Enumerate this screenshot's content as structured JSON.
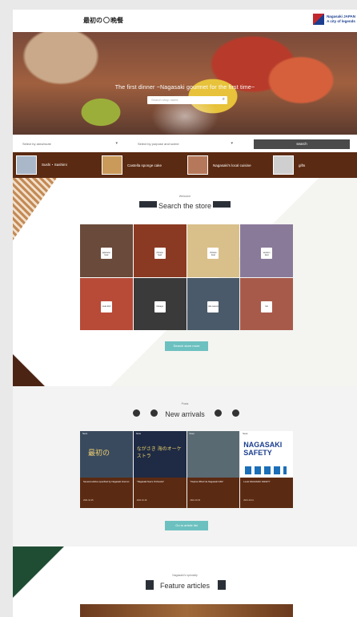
{
  "header": {
    "logo_text_left": "最初の",
    "logo_text_right": "晩餐",
    "brand_line1": "Nagasaki JAPAN",
    "brand_line2": "A city of legends"
  },
  "hero": {
    "title": "The first dinner ~Nagasaki gourmet for the first time~",
    "search_placeholder": "Search shop name"
  },
  "filters": {
    "area_label": "Select by area/route",
    "purpose_label": "Select by purpose and scene",
    "search_label": "search"
  },
  "categories": [
    {
      "label": "Sushi・Sashimi",
      "color": "#a9b7c9"
    },
    {
      "label": "Castella sponge cake",
      "color": "#c99a5a"
    },
    {
      "label": "Nagasaki's local cuisine",
      "color": "#b6785a"
    },
    {
      "label": "gifts",
      "color": "#cfcfcf"
    }
  ],
  "store_section": {
    "kicker": "Welcome",
    "title": "Search the store",
    "more_label": "Search store more",
    "tiles": [
      {
        "badge": "japanese food",
        "color": "#6a4a3a"
      },
      {
        "badge": "chinese food",
        "color": "#8a3a22"
      },
      {
        "badge": "chinese food",
        "color": "#d9c08a"
      },
      {
        "badge": "western food",
        "color": "#8a7a9a"
      },
      {
        "badge": "meat dish",
        "color": "#b84a38"
      },
      {
        "badge": "izakaya",
        "color": "#3a3a3a"
      },
      {
        "badge": "cafe sweets",
        "color": "#4a5a6a"
      },
      {
        "badge": "bar",
        "color": "#a85a4a"
      }
    ]
  },
  "arrivals_section": {
    "kicker": "Posts",
    "title": "New arrivals",
    "more_label": "Go to article list",
    "cards": [
      {
        "tag": "News",
        "title": "Several articles specified by Nagasaki Internet",
        "date": "2021.10.25",
        "color": "#3a4a5e"
      },
      {
        "tag": "News",
        "title": "\"Nagasaki Sea's Orchestra\"",
        "date": "2021.10.19",
        "color": "#1f2a44"
      },
      {
        "tag": "News",
        "title": "\"Dejima Wharf de Nagasaki Gifts\"",
        "date": "2021.10.15",
        "color": "#5a6a72"
      },
      {
        "tag": "News",
        "title": "Local NAGASAKI SAFETY",
        "date": "2021.10.14",
        "color": "#ffffff"
      }
    ],
    "card2_text": "ながさき 海のオーケストラ",
    "card4_text": "NAGASAKI SAFETY"
  },
  "feature_section": {
    "kicker": "Nagasaki's specialty",
    "title": "Feature articles"
  },
  "colors": {
    "accent_teal": "#6cc1c0",
    "brown": "#5b2a12",
    "green": "#1f4d34"
  }
}
